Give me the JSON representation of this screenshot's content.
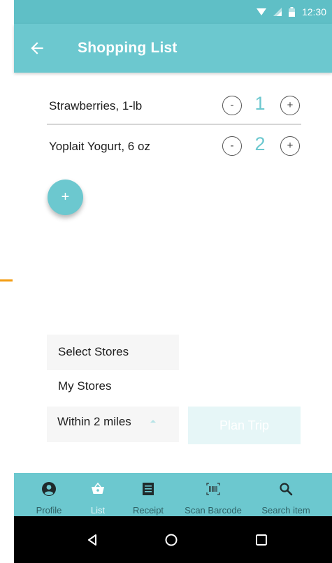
{
  "status_bar": {
    "time": "12:30"
  },
  "app_bar": {
    "title": "Shopping List"
  },
  "items": [
    {
      "name": "Strawberries, 1-lb",
      "quantity": "1",
      "minus_label": "-",
      "plus_label": "+"
    },
    {
      "name": "Yoplait Yogurt, 6 oz",
      "quantity": "2",
      "minus_label": "-",
      "plus_label": "+"
    }
  ],
  "fab": {
    "label": "+"
  },
  "stores": {
    "select_label": "Select Stores",
    "my_stores_label": "My Stores",
    "distance_value": "Within 2 miles",
    "plan_button": "Plan Trip"
  },
  "bottom_nav": [
    {
      "label": "Profile",
      "icon": "profile-icon"
    },
    {
      "label": "List",
      "icon": "basket-icon",
      "active": true
    },
    {
      "label": "Receipt",
      "icon": "receipt-icon"
    },
    {
      "label": "Scan Barcode",
      "icon": "barcode-icon"
    },
    {
      "label": "Search item",
      "icon": "search-icon"
    }
  ],
  "colors": {
    "primary": "#6cc8cf",
    "status_bar": "#5fbfc6",
    "accent_orange": "#f39c12",
    "nav_label": "#2f6266"
  }
}
